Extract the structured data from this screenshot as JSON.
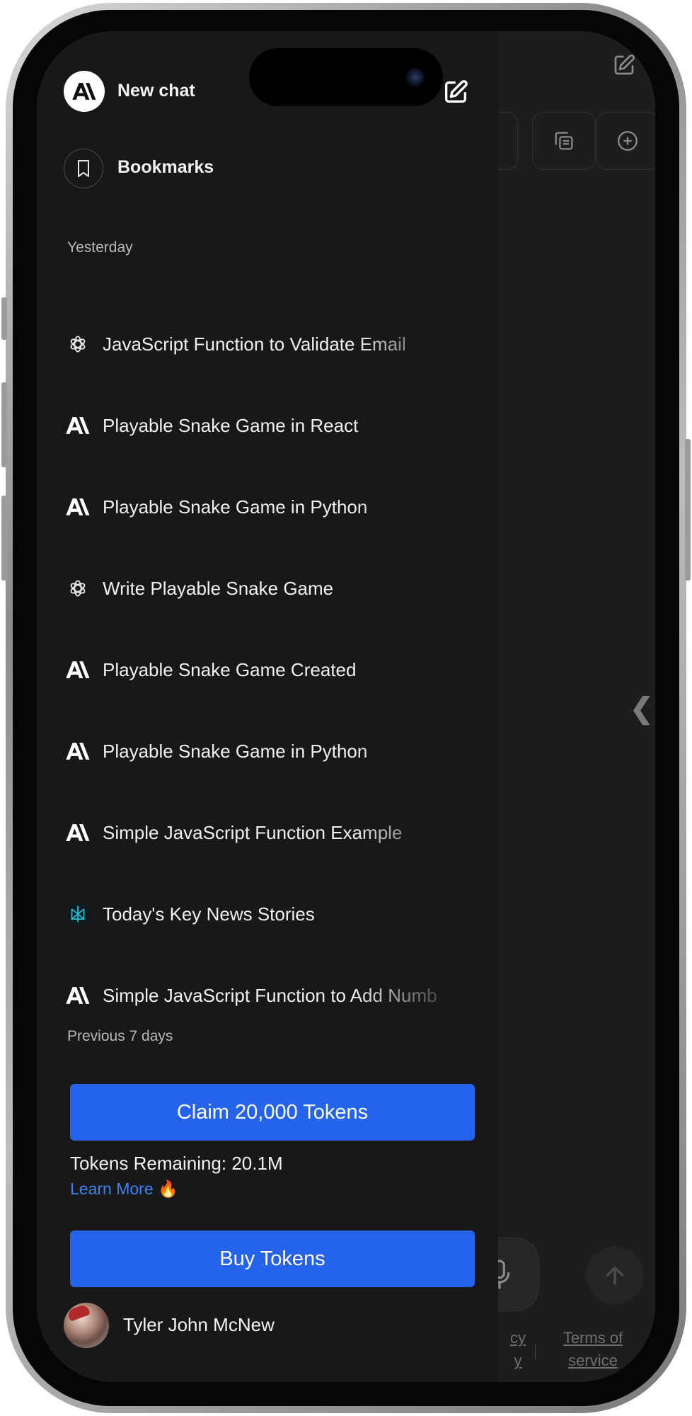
{
  "sidebar": {
    "new_chat_label": "New chat",
    "bookmarks_label": "Bookmarks",
    "sections": {
      "yesterday": "Yesterday",
      "previous_7_days": "Previous 7 days"
    },
    "conversations": [
      {
        "title": "JavaScript Function to Validate Email",
        "icon": "openai-icon"
      },
      {
        "title": "Playable Snake Game in React",
        "icon": "anthropic-icon"
      },
      {
        "title": "Playable Snake Game in Python",
        "icon": "anthropic-icon"
      },
      {
        "title": "Write Playable Snake Game",
        "icon": "openai-icon"
      },
      {
        "title": "Playable Snake Game Created",
        "icon": "anthropic-icon"
      },
      {
        "title": "Playable Snake Game in Python",
        "icon": "anthropic-icon"
      },
      {
        "title": "Simple JavaScript Function Example",
        "icon": "anthropic-icon"
      },
      {
        "title": "Today's Key News Stories",
        "icon": "perplexity-icon"
      },
      {
        "title": "Simple JavaScript Function to Add Numb",
        "icon": "anthropic-icon"
      }
    ],
    "claim_button": "Claim 20,000 Tokens",
    "tokens_remaining": "Tokens Remaining: 20.1M",
    "learn_more": "Learn More 🔥",
    "buy_button": "Buy Tokens",
    "user_name": "Tyler John McNew"
  },
  "background": {
    "footer_left_line1": "cy",
    "footer_left_line2": "y",
    "footer_terms_line1": "Terms of",
    "footer_terms_line2": "service"
  },
  "colors": {
    "accent_blue": "#2563eb",
    "link_blue": "#3b82f6",
    "drawer_bg": "#181818",
    "perplexity_teal": "#20b8cd"
  }
}
